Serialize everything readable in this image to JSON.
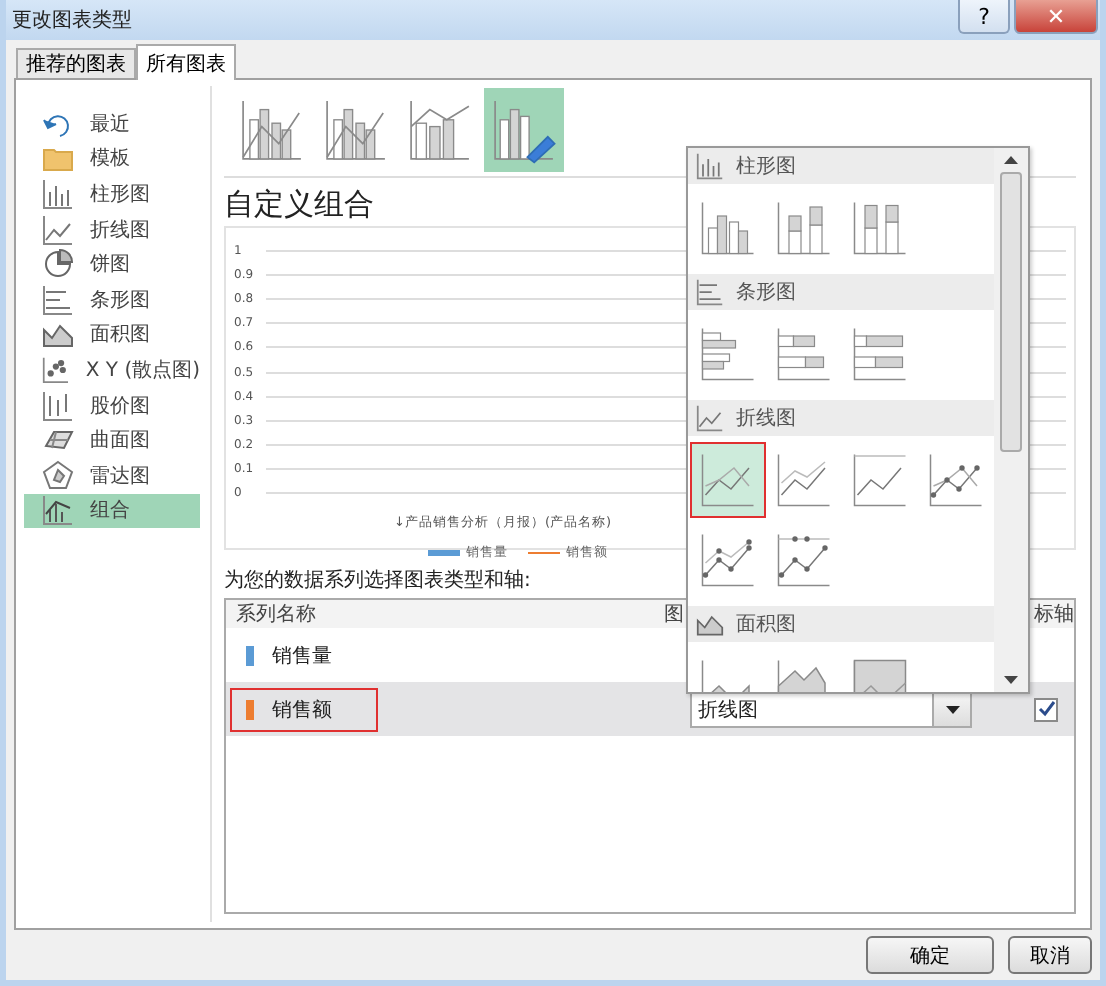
{
  "window": {
    "title": "更改图表类型",
    "help_button": "?",
    "close_button": "✕"
  },
  "tabs": [
    {
      "label": "推荐的图表",
      "selected": false
    },
    {
      "label": "所有图表",
      "selected": true
    }
  ],
  "sidebar": {
    "items": [
      {
        "label": "最近",
        "selected": false
      },
      {
        "label": "模板",
        "selected": false
      },
      {
        "label": "柱形图",
        "selected": false
      },
      {
        "label": "折线图",
        "selected": false
      },
      {
        "label": "饼图",
        "selected": false
      },
      {
        "label": "条形图",
        "selected": false
      },
      {
        "label": "面积图",
        "selected": false
      },
      {
        "label": "X Y (散点图)",
        "selected": false
      },
      {
        "label": "股价图",
        "selected": false
      },
      {
        "label": "曲面图",
        "selected": false
      },
      {
        "label": "雷达图",
        "selected": false
      },
      {
        "label": "组合",
        "selected": true
      }
    ]
  },
  "subtypes": [
    {
      "selected": false
    },
    {
      "selected": false
    },
    {
      "selected": false
    },
    {
      "selected": true
    }
  ],
  "combo_title": "自定义组合",
  "preview": {
    "yticks": [
      "1",
      "0.9",
      "0.8",
      "0.7",
      "0.6",
      "0.5",
      "0.4",
      "0.3",
      "0.2",
      "0.1",
      "0"
    ],
    "x_axis_title": "↓产品销售分析（月报）(产品名称)",
    "legend": [
      {
        "label": "销售量",
        "color": "#5b9bd5",
        "kind": "bar"
      },
      {
        "label": "销售额",
        "color": "#ed7d31",
        "kind": "line"
      }
    ]
  },
  "series_prompt": "为您的数据系列选择图表类型和轴:",
  "series_table": {
    "columns": [
      "系列名称",
      "图",
      "标轴"
    ],
    "rows": [
      {
        "name": "销售量",
        "color": "#5b9bd5",
        "selected": false
      },
      {
        "name": "销售额",
        "color": "#ed7d31",
        "selected": true,
        "chart_type": "折线图",
        "secondary_axis": true
      }
    ]
  },
  "dropdown": {
    "sections": [
      {
        "label": "柱形图",
        "kind": "column",
        "options": [
          {
            "selected": false
          },
          {
            "selected": false
          },
          {
            "selected": false
          }
        ]
      },
      {
        "label": "条形图",
        "kind": "bar",
        "options": [
          {
            "selected": false
          },
          {
            "selected": false
          },
          {
            "selected": false
          }
        ]
      },
      {
        "label": "折线图",
        "kind": "line",
        "options": [
          {
            "selected": true
          },
          {
            "selected": false
          },
          {
            "selected": false
          },
          {
            "selected": false
          },
          {
            "selected": false
          },
          {
            "selected": false
          }
        ]
      },
      {
        "label": "面积图",
        "kind": "area",
        "options": [
          {
            "selected": false
          },
          {
            "selected": false
          },
          {
            "selected": false
          }
        ]
      }
    ]
  },
  "buttons": [
    "确定",
    "取消"
  ]
}
